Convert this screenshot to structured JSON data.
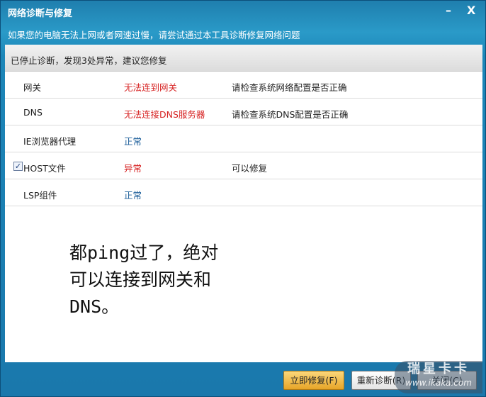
{
  "window": {
    "title": "网络诊断与修复",
    "subtitle": "如果您的电脑无法上网或者网速过慢，请尝试通过本工具诊断修复网络问题",
    "minimize": "–",
    "close": "X"
  },
  "status": "已停止诊断，发现3处异常，建议您修复",
  "rows": [
    {
      "name": "网关",
      "result": "无法连到网关",
      "advice": "请检查系统网络配置是否正确"
    },
    {
      "name": "DNS",
      "result": "无法连接DNS服务器",
      "advice": "请检查系统DNS配置是否正确"
    },
    {
      "name": "IE浏览器代理",
      "result": "正常",
      "advice": ""
    },
    {
      "name": "HOST文件",
      "result": "异常",
      "advice": "可以修复",
      "checked": true
    },
    {
      "name": "LSP组件",
      "result": "正常",
      "advice": ""
    }
  ],
  "note": [
    "都ping过了，绝对",
    "可以连接到网关和",
    "DNS。"
  ],
  "buttons": {
    "fix": "立即修复(F)",
    "rediagnose": "重新诊断(R)",
    "close": "关闭(C)"
  },
  "watermark": {
    "brand": "瑞星卡卡",
    "url": "www.ikaka.com"
  }
}
